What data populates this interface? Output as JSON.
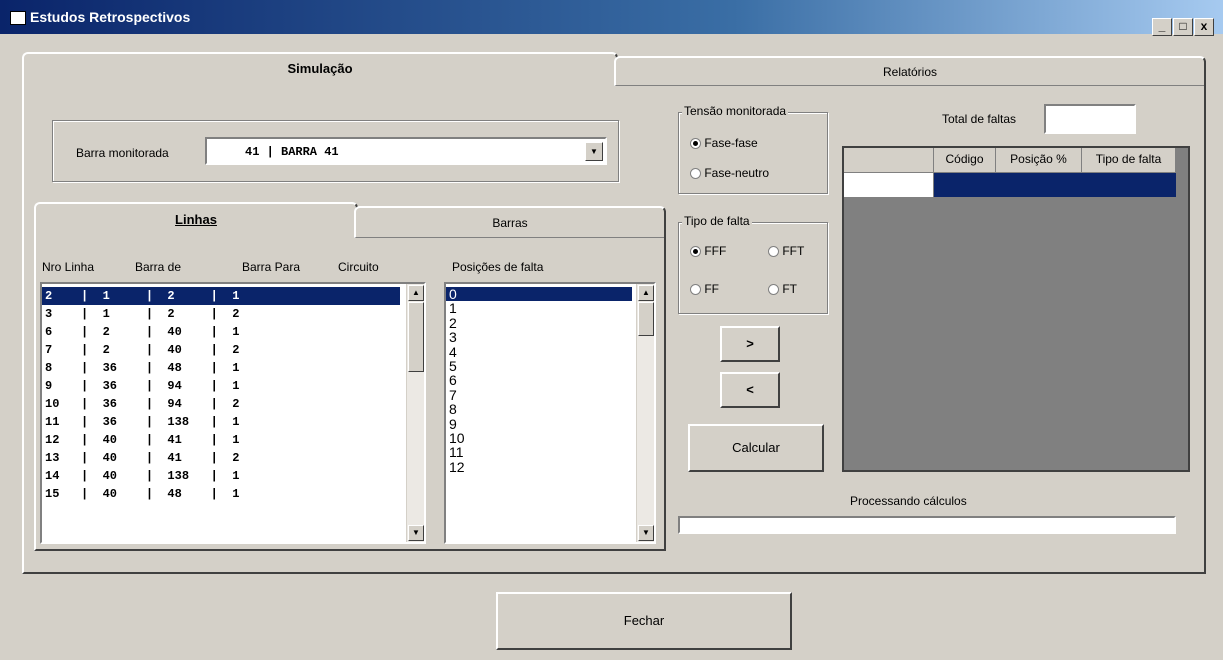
{
  "window": {
    "title": "Estudos Retrospectivos",
    "min": "_",
    "max": "□",
    "close": "x"
  },
  "tabs": {
    "simulacao": "Simulação",
    "relatorios": "Relatórios"
  },
  "barra": {
    "label": "Barra monitorada",
    "value": "41 | BARRA 41"
  },
  "subtabs": {
    "linhas": "Linhas",
    "barras": "Barras"
  },
  "lines_table": {
    "headers": [
      "Nro Linha",
      "Barra de",
      "Barra Para",
      "Circuito"
    ],
    "rows": [
      {
        "text": "2    |  1     |  2     |  1",
        "selected": true
      },
      {
        "text": "3    |  1     |  2     |  2"
      },
      {
        "text": "6    |  2     |  40    |  1"
      },
      {
        "text": "7    |  2     |  40    |  2"
      },
      {
        "text": "8    |  36    |  48    |  1"
      },
      {
        "text": "9    |  36    |  94    |  1"
      },
      {
        "text": "10   |  36    |  94    |  2"
      },
      {
        "text": "11   |  36    |  138   |  1"
      },
      {
        "text": "12   |  40    |  41    |  1"
      },
      {
        "text": "13   |  40    |  41    |  2"
      },
      {
        "text": "14   |  40    |  138   |  1"
      },
      {
        "text": "15   |  40    |  48    |  1"
      }
    ]
  },
  "positions": {
    "label": "Posições de falta",
    "items": [
      "0",
      "1",
      "2",
      "3",
      "4",
      "5",
      "6",
      "7",
      "8",
      "9",
      "10",
      "11",
      "12"
    ]
  },
  "tensao": {
    "title": "Tensão monitorada",
    "options": [
      "Fase-fase",
      "Fase-neutro"
    ],
    "selected": 0
  },
  "tipo_falta": {
    "title": "Tipo de falta",
    "options": [
      "FFF",
      "FFT",
      "FF",
      "FT"
    ],
    "selected": 0
  },
  "buttons": {
    "add": ">",
    "remove": "<",
    "calcular": "Calcular",
    "fechar": "Fechar"
  },
  "total": {
    "label": "Total de faltas",
    "value": ""
  },
  "grid": {
    "headers": [
      "",
      "Código",
      "Posição %",
      "Tipo de falta"
    ]
  },
  "processing": {
    "label": "Processando cálculos",
    "progress": 0
  },
  "colors": {
    "selection": "#0a246a",
    "face": "#d4d0c8",
    "grid_empty": "#808080"
  }
}
